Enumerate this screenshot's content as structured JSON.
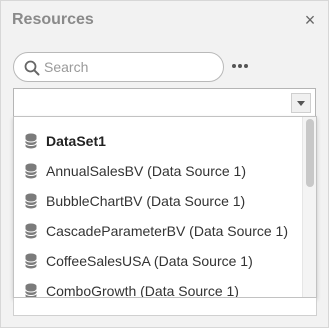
{
  "panel": {
    "title": "Resources",
    "close_glyph": "×"
  },
  "search": {
    "placeholder": "Search",
    "value": "",
    "icon": "search-icon"
  },
  "more": {
    "icon": "more-horizontal-icon"
  },
  "select": {
    "value": "",
    "icon": "chevron-down-icon"
  },
  "dropdown": {
    "items": [
      {
        "label": "DataSet1",
        "icon": "database-icon",
        "bold": true
      },
      {
        "label": "AnnualSalesBV (Data Source 1)",
        "icon": "database-icon"
      },
      {
        "label": "BubbleChartBV (Data Source 1)",
        "icon": "database-icon"
      },
      {
        "label": "CascadeParameterBV (Data Source 1)",
        "icon": "database-icon"
      },
      {
        "label": "CoffeeSalesUSA (Data Source 1)",
        "icon": "database-icon"
      },
      {
        "label": "ComboGrowth (Data Source 1)",
        "icon": "database-icon"
      }
    ]
  },
  "colors": {
    "panel_bg": "#f2f2f2",
    "title_text": "#8a8a8a",
    "icon_gray": "#6e6e6e"
  }
}
